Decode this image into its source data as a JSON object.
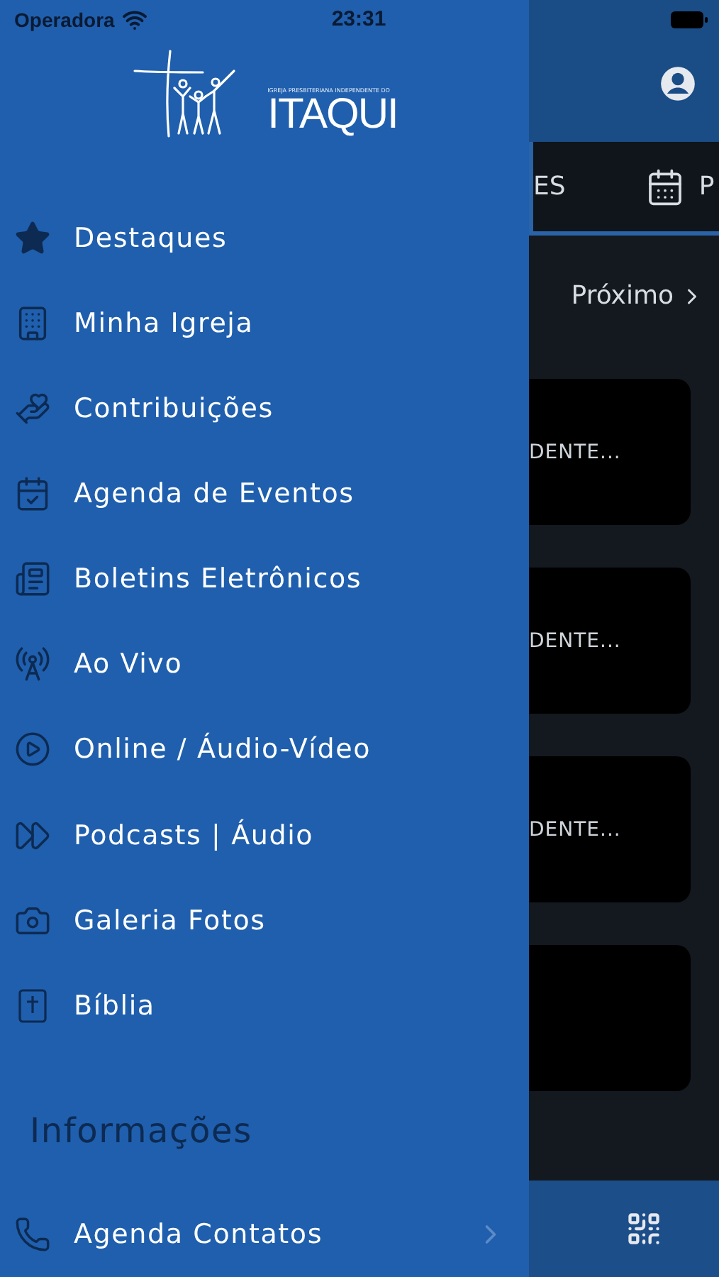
{
  "status_bar": {
    "carrier": "Operadora",
    "time": "23:31"
  },
  "drawer": {
    "logo": {
      "tagline": "IGREJA PRESBITERIANA INDEPENDENTE DO",
      "name": "ITAQUI"
    },
    "items": [
      {
        "label": "Destaques"
      },
      {
        "label": "Minha Igreja"
      },
      {
        "label": "Contribuições"
      },
      {
        "label": "Agenda de Eventos"
      },
      {
        "label": "Boletins Eletrônicos"
      },
      {
        "label": "Ao Vivo"
      },
      {
        "label": "Online / Áudio-Vídeo"
      },
      {
        "label": "Podcasts | Áudio"
      },
      {
        "label": "Galeria Fotos"
      },
      {
        "label": "Bíblia"
      }
    ],
    "section": {
      "title": "Informações",
      "items": [
        {
          "label": "Agenda Contatos"
        }
      ]
    }
  },
  "background_screen": {
    "tabs": [
      {
        "label": "ES"
      },
      {
        "label": "P"
      }
    ],
    "next_link": "Próximo",
    "cards": [
      {
        "kind": "text",
        "title": "DENTE..."
      },
      {
        "kind": "text",
        "title": "DENTE..."
      },
      {
        "kind": "text",
        "title": "DENTE..."
      },
      {
        "kind": "blank"
      }
    ]
  }
}
